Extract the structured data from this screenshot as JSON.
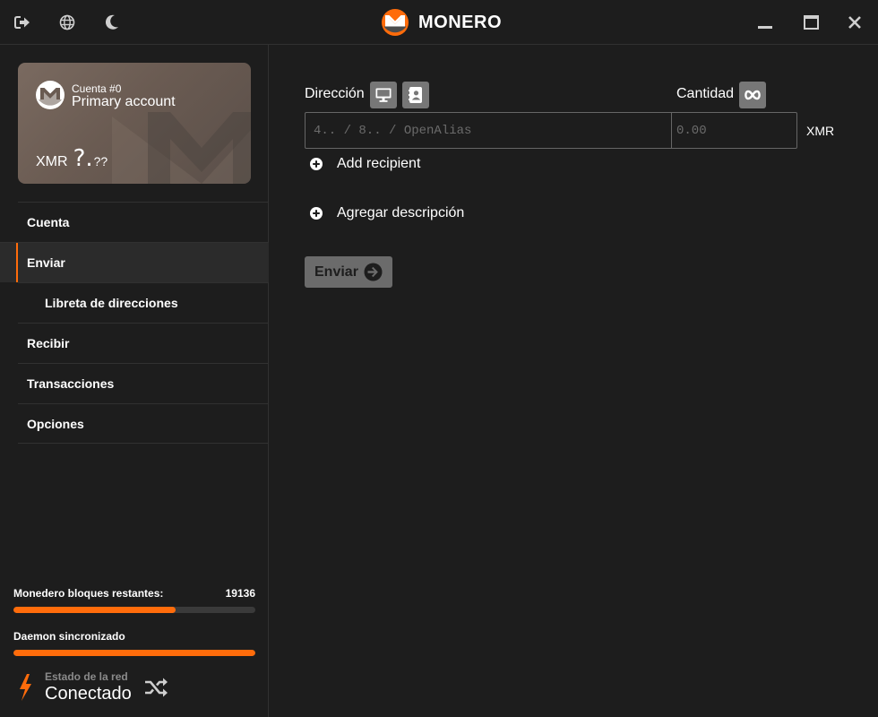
{
  "titlebar": {
    "brand": "MONERO",
    "icons": [
      "logout-icon",
      "globe-icon",
      "moon-icon",
      "minimize-icon",
      "maximize-icon",
      "close-icon"
    ]
  },
  "account_card": {
    "account_number": "Cuenta #0",
    "account_name": "Primary account",
    "currency": "XMR",
    "balance_big": "?.",
    "balance_small": "??"
  },
  "menu": {
    "items": [
      {
        "label": "Cuenta"
      },
      {
        "label": "Enviar"
      },
      {
        "label": "Libreta de direcciones"
      },
      {
        "label": "Recibir"
      },
      {
        "label": "Transacciones"
      },
      {
        "label": "Opciones"
      }
    ]
  },
  "sync": {
    "wallet_label": "Monedero bloques restantes:",
    "wallet_value": "19136",
    "wallet_progress": 0.67,
    "daemon_label": "Daemon sincronizado",
    "daemon_progress": 1.0
  },
  "network": {
    "label": "Estado de la red",
    "value": "Conectado"
  },
  "send_form": {
    "address_label": "Dirección",
    "amount_label": "Cantidad",
    "address_placeholder": "4.. / 8.. / OpenAlias",
    "amount_placeholder": "0.00",
    "unit": "XMR",
    "add_recipient": "Add recipient",
    "add_description": "Agregar descripción",
    "send_button": "Enviar"
  },
  "colors": {
    "accent": "#ff6c0b",
    "background": "#1d1d1d",
    "button_gray": "#777777"
  }
}
